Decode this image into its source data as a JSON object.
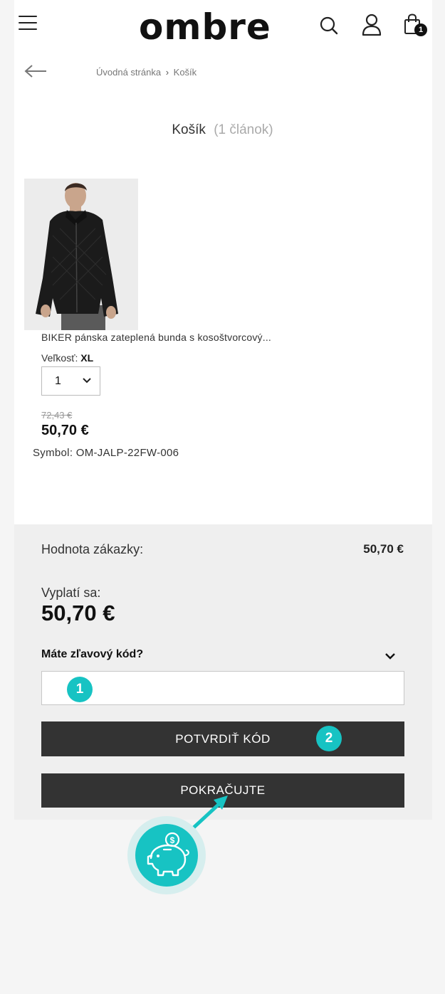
{
  "header": {
    "logo": "ombre",
    "cart_count": "1"
  },
  "breadcrumb": {
    "home": "Úvodná stránka",
    "separator": "›",
    "current": "Košík"
  },
  "cart": {
    "title": "Košík",
    "count": "(1 článok)"
  },
  "product": {
    "name": "BIKER pánska zateplená bunda s kosoštvorcový...",
    "size_label": "Veľkosť:",
    "size_value": "XL",
    "quantity": "1",
    "old_price": "72,43 €",
    "price": "50,70 €",
    "symbol": "Symbol: OM-JALP-22FW-006"
  },
  "summary": {
    "order_label": "Hodnota zákazky:",
    "order_value": "50,70 €",
    "pay_label": "Vyplatí sa:",
    "pay_value": "50,70 €",
    "discount_label": "Máte zľavový kód?",
    "discount_placeholder": "",
    "confirm_button": "POTVRDIŤ KÓD",
    "continue_button": "POKRAČUJTE"
  },
  "annotations": {
    "marker_1": "1",
    "marker_2": "2"
  },
  "colors": {
    "accent": "#17c3c3",
    "button": "#333333"
  }
}
